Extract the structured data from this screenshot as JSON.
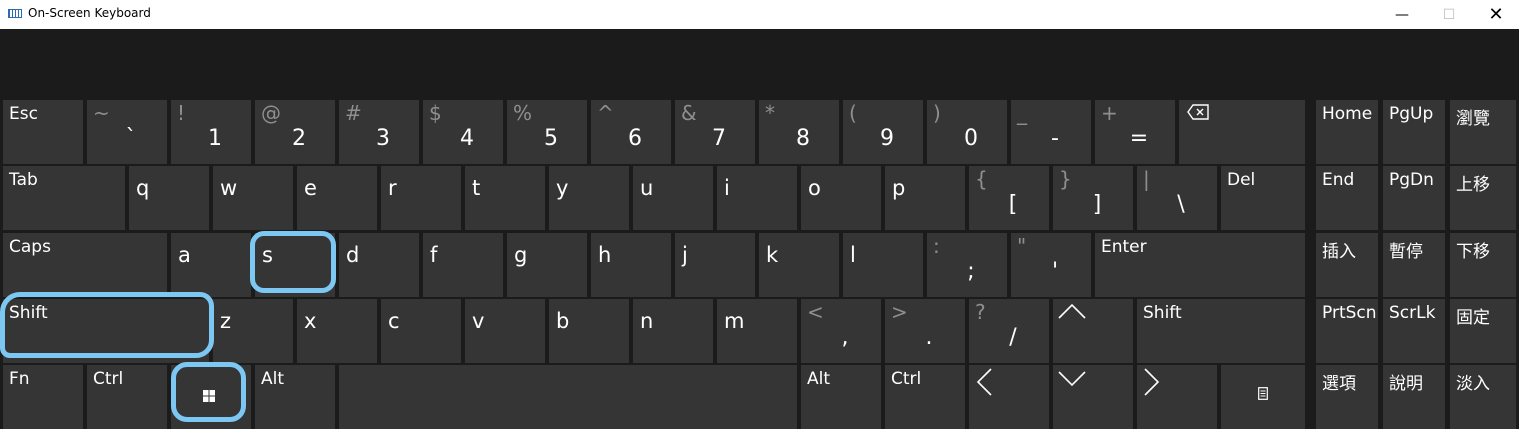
{
  "window": {
    "title": "On-Screen Keyboard",
    "icons": {
      "app": "keyboard-icon",
      "minimize": "minimize-icon",
      "maximize": "maximize-icon",
      "close": "close-icon"
    }
  },
  "keyboard": {
    "row1": {
      "esc": "Esc",
      "backtick": {
        "upper": "~",
        "lower": "`"
      },
      "1": {
        "upper": "!",
        "lower": "1"
      },
      "2": {
        "upper": "@",
        "lower": "2"
      },
      "3": {
        "upper": "#",
        "lower": "3"
      },
      "4": {
        "upper": "$",
        "lower": "4"
      },
      "5": {
        "upper": "%",
        "lower": "5"
      },
      "6": {
        "upper": "^",
        "lower": "6"
      },
      "7": {
        "upper": "&",
        "lower": "7"
      },
      "8": {
        "upper": "*",
        "lower": "8"
      },
      "9": {
        "upper": "(",
        "lower": "9"
      },
      "0": {
        "upper": ")",
        "lower": "0"
      },
      "minus": {
        "upper": "_",
        "lower": "-"
      },
      "equals": {
        "upper": "+",
        "lower": "="
      },
      "backspace_icon": "backspace-icon",
      "home": "Home",
      "pgup": "PgUp",
      "browse": "瀏覽"
    },
    "row2": {
      "tab": "Tab",
      "letters": [
        "q",
        "w",
        "e",
        "r",
        "t",
        "y",
        "u",
        "i",
        "o",
        "p"
      ],
      "lbracket": {
        "upper": "{",
        "lower": "["
      },
      "rbracket": {
        "upper": "}",
        "lower": "]"
      },
      "backslash": {
        "upper": "|",
        "lower": "\\"
      },
      "del": "Del",
      "end": "End",
      "pgdn": "PgDn",
      "moveup": "上移"
    },
    "row3": {
      "caps": "Caps",
      "letters": [
        "a",
        "s",
        "d",
        "f",
        "g",
        "h",
        "j",
        "k",
        "l"
      ],
      "semicolon": {
        "upper": ":",
        "lower": ";"
      },
      "quote": {
        "upper": "\"",
        "lower": "'"
      },
      "enter": "Enter",
      "insert": "插入",
      "pause": "暫停",
      "movedown": "下移"
    },
    "row4": {
      "shift_left": "Shift",
      "letters": [
        "z",
        "x",
        "c",
        "v",
        "b",
        "n",
        "m"
      ],
      "comma": {
        "upper": "<",
        "lower": ","
      },
      "period": {
        "upper": ">",
        "lower": "."
      },
      "slash": {
        "upper": "?",
        "lower": "/"
      },
      "up_icon": "chevron-up-icon",
      "shift_right": "Shift",
      "prtscn": "PrtScn",
      "scrlk": "ScrLk",
      "dock": "固定"
    },
    "row5": {
      "fn": "Fn",
      "ctrl_left": "Ctrl",
      "win_icon": "windows-icon",
      "alt_left": "Alt",
      "alt_right": "Alt",
      "ctrl_right": "Ctrl",
      "left_icon": "chevron-left-icon",
      "down_icon": "chevron-down-icon",
      "right_icon": "chevron-right-icon",
      "menu_icon": "context-menu-icon",
      "options": "選項",
      "help": "說明",
      "fade": "淡入"
    }
  },
  "annotation_color": "#7cc8f3"
}
